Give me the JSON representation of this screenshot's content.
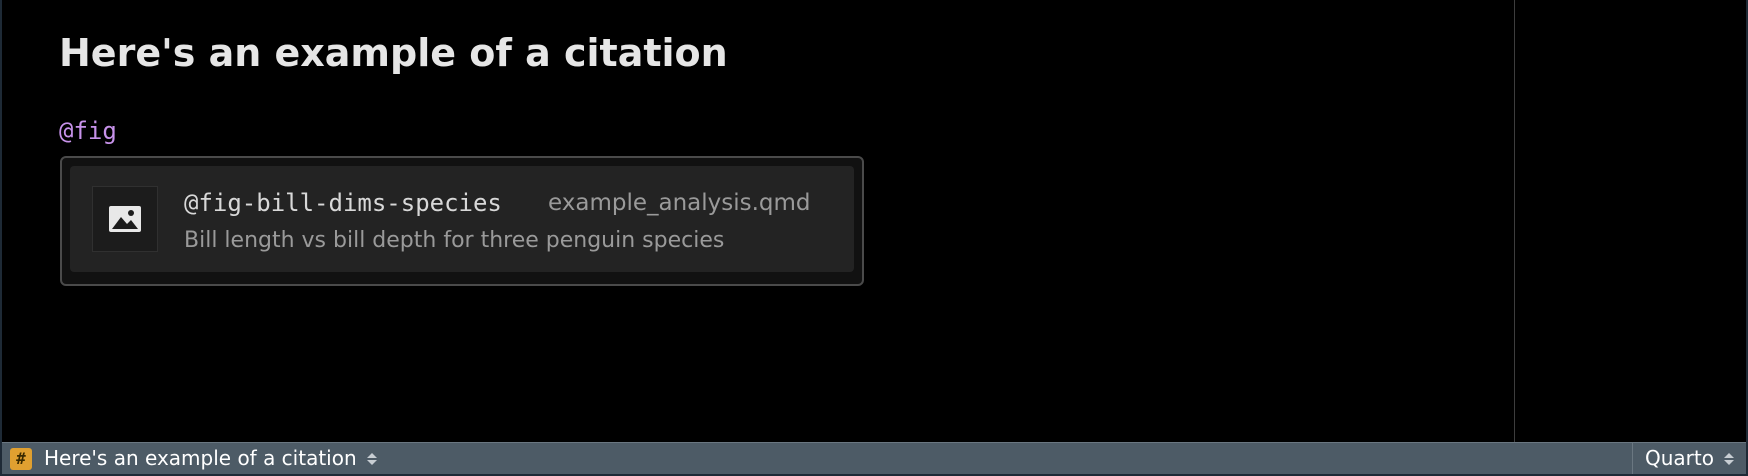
{
  "editor": {
    "heading": "Here's an example of a citation",
    "cite_text": "@fig"
  },
  "completion": {
    "items": [
      {
        "icon": "image-icon",
        "id": "@fig-bill-dims-species",
        "file": "example_analysis.qmd",
        "caption": "Bill length vs bill depth for three penguin species"
      }
    ]
  },
  "statusbar": {
    "section_icon": "hash-icon",
    "section_icon_glyph": "#",
    "section_label": "Here's an example of a citation",
    "language": "Quarto"
  },
  "colors": {
    "background": "#000000",
    "heading": "#e6e6e6",
    "cite": "#c792ea",
    "statusbar": "#4d5b66",
    "hash_badge": "#e0a030"
  }
}
